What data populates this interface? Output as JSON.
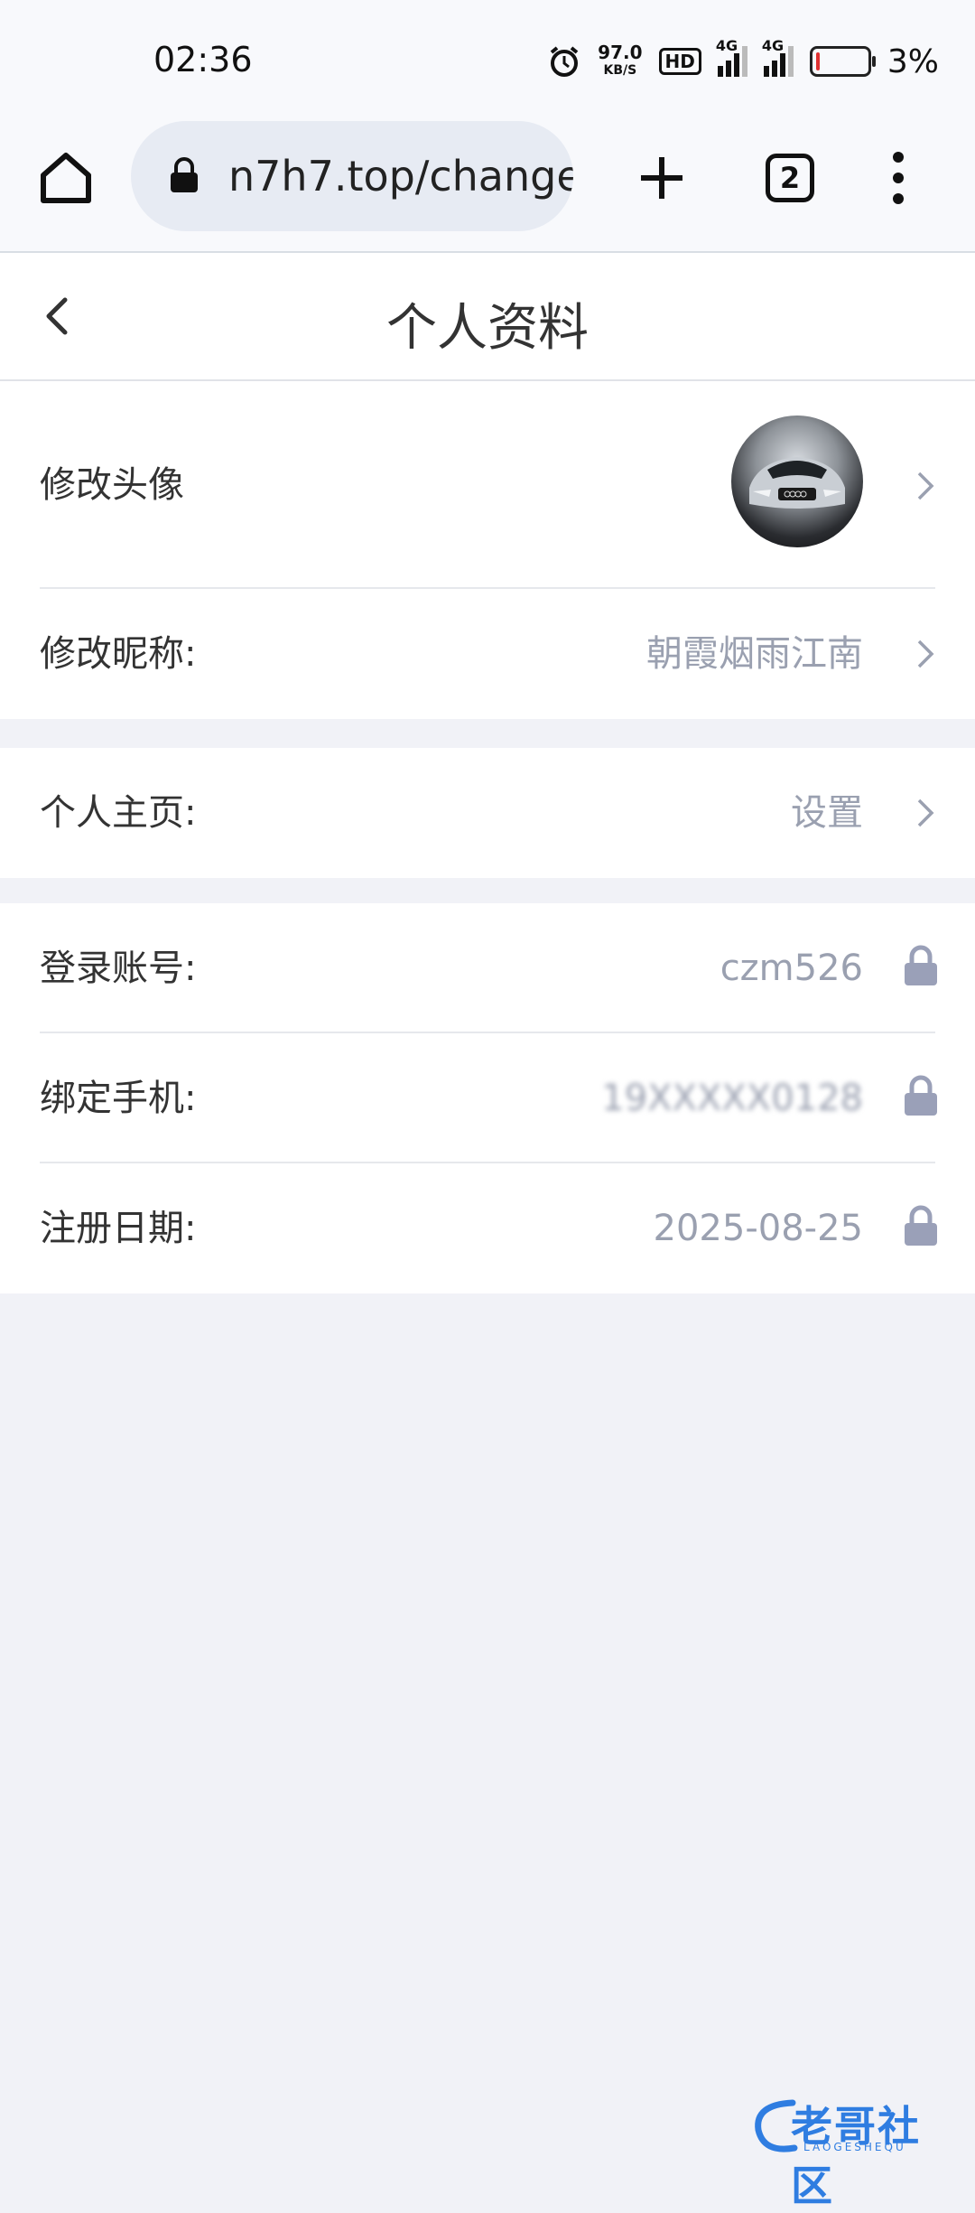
{
  "status_bar": {
    "time": "02:36",
    "net_speed_value": "97.0",
    "net_speed_unit": "KB/S",
    "hd_badge": "HD",
    "sim1_label": "4G",
    "sim2_label": "4G",
    "battery_level": 0.03,
    "battery_text": "3%",
    "battery_low_color": "#e03131"
  },
  "browser": {
    "url": "n7h7.top/change",
    "tab_count": "2"
  },
  "header": {
    "title": "个人资料"
  },
  "profile": {
    "avatar_label": "修改头像",
    "nickname_label": "修改昵称:",
    "nickname_value": "朝霞烟雨江南",
    "homepage_label": "个人主页:",
    "homepage_value": "设置",
    "account_label": "登录账号:",
    "account_value": "czm526",
    "phone_label": "绑定手机:",
    "phone_value": "19XXXXX0128",
    "register_label": "注册日期:",
    "register_value": "2025-08-25"
  },
  "watermark": {
    "text": "老哥社区",
    "subtext": "LAOGESHEQU"
  },
  "colors": {
    "page_bg": "#f1f2f7",
    "value_text": "#9aa0b0",
    "lock_icon": "#9aa0b8",
    "watermark": "#2f7de1"
  }
}
